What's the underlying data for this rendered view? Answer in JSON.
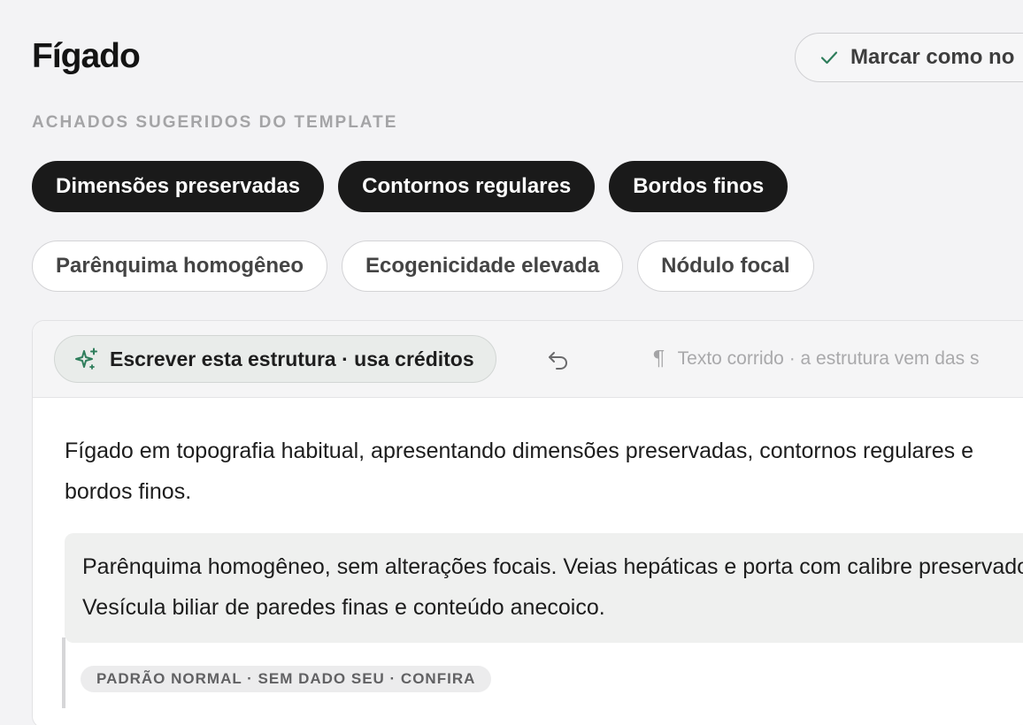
{
  "header": {
    "title": "Fígado",
    "mark_normal_label": "Marcar como no"
  },
  "suggestions": {
    "section_label": "ACHADOS SUGERIDOS DO TEMPLATE",
    "selected_chips": [
      "Dimensões preservadas",
      "Contornos regulares",
      "Bordos finos"
    ],
    "unselected_chips": [
      "Parênquima homogêneo",
      "Ecogenicidade elevada",
      "Nódulo focal"
    ]
  },
  "editor": {
    "ai_button_label": "Escrever esta estrutura · usa créditos",
    "hint_text": "Texto corrido · a estrutura vem das s",
    "body_text": "Fígado em topografia habitual, apresentando dimensões preservadas, contornos regulares e bordos finos.",
    "suggested_block_text": "Parênquima homogêneo, sem alterações focais. Veias hepáticas e porta com calibre preservado. Vesícula biliar de paredes finas e conteúdo anecoico.",
    "note_badge": "PADRÃO NORMAL · SEM DADO SEU · CONFIRA"
  },
  "icons": {
    "mark_normal": "check-icon",
    "ai_button": "sparkle-icon",
    "undo": "undo-icon",
    "hint": "pilcrow-icon"
  },
  "colors": {
    "accent_green": "#2e7d5b",
    "chip_selected_bg": "#1a1a1a",
    "panel_bg": "#f3f3f5"
  }
}
